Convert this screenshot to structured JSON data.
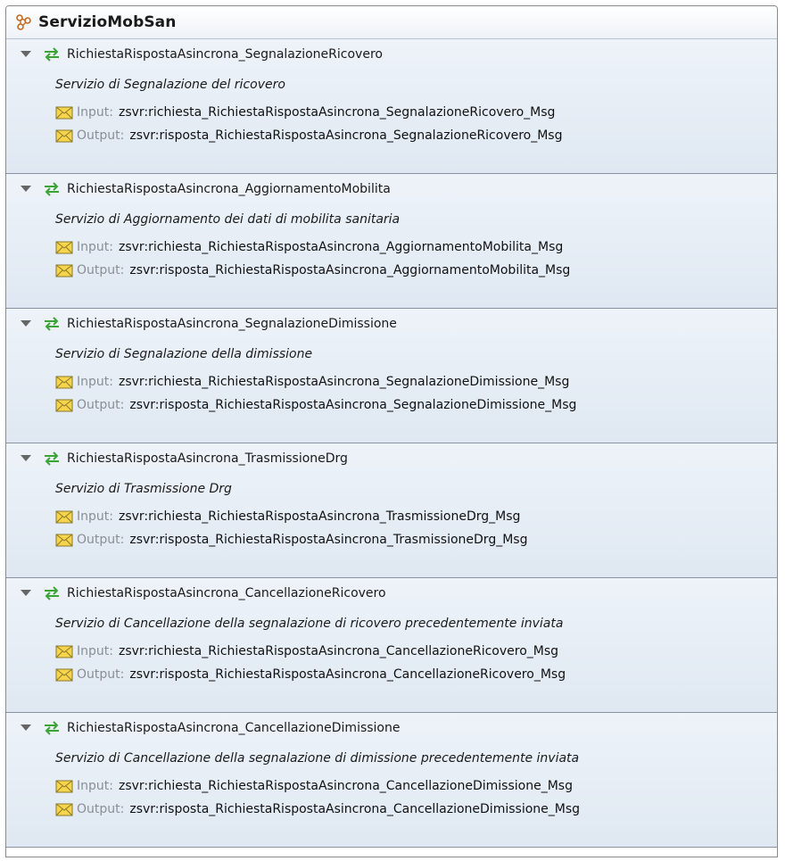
{
  "service": {
    "name": "ServizioMobSan"
  },
  "labels": {
    "input": "Input:",
    "output": "Output:"
  },
  "colors": {
    "header_bg": "#eef2f7",
    "row_bg": "#e4ecf5",
    "arrow_green": "#3aa535",
    "envelope_yellow": "#f6d44c"
  },
  "operations": [
    {
      "name": "RichiestaRispostaAsincrona_SegnalazioneRicovero",
      "description": "Servizio di Segnalazione del ricovero",
      "input": "zsvr:richiesta_RichiestaRispostaAsincrona_SegnalazioneRicovero_Msg",
      "output": "zsvr:risposta_RichiestaRispostaAsincrona_SegnalazioneRicovero_Msg"
    },
    {
      "name": "RichiestaRispostaAsincrona_AggiornamentoMobilita",
      "description": "Servizio di Aggiornamento dei dati di mobilita sanitaria",
      "input": "zsvr:richiesta_RichiestaRispostaAsincrona_AggiornamentoMobilita_Msg",
      "output": "zsvr:risposta_RichiestaRispostaAsincrona_AggiornamentoMobilita_Msg"
    },
    {
      "name": "RichiestaRispostaAsincrona_SegnalazioneDimissione",
      "description": "Servizio di Segnalazione della dimissione",
      "input": "zsvr:richiesta_RichiestaRispostaAsincrona_SegnalazioneDimissione_Msg",
      "output": "zsvr:risposta_RichiestaRispostaAsincrona_SegnalazioneDimissione_Msg"
    },
    {
      "name": "RichiestaRispostaAsincrona_TrasmissioneDrg",
      "description": "Servizio di Trasmissione Drg",
      "input": "zsvr:richiesta_RichiestaRispostaAsincrona_TrasmissioneDrg_Msg",
      "output": "zsvr:risposta_RichiestaRispostaAsincrona_TrasmissioneDrg_Msg"
    },
    {
      "name": "RichiestaRispostaAsincrona_CancellazioneRicovero",
      "description": "Servizio di Cancellazione della segnalazione di ricovero precedentemente inviata",
      "input": "zsvr:richiesta_RichiestaRispostaAsincrona_CancellazioneRicovero_Msg",
      "output": "zsvr:risposta_RichiestaRispostaAsincrona_CancellazioneRicovero_Msg"
    },
    {
      "name": "RichiestaRispostaAsincrona_CancellazioneDimissione",
      "description": "Servizio di Cancellazione della segnalazione di dimissione precedentemente inviata",
      "input": "zsvr:richiesta_RichiestaRispostaAsincrona_CancellazioneDimissione_Msg",
      "output": "zsvr:risposta_RichiestaRispostaAsincrona_CancellazioneDimissione_Msg"
    }
  ]
}
